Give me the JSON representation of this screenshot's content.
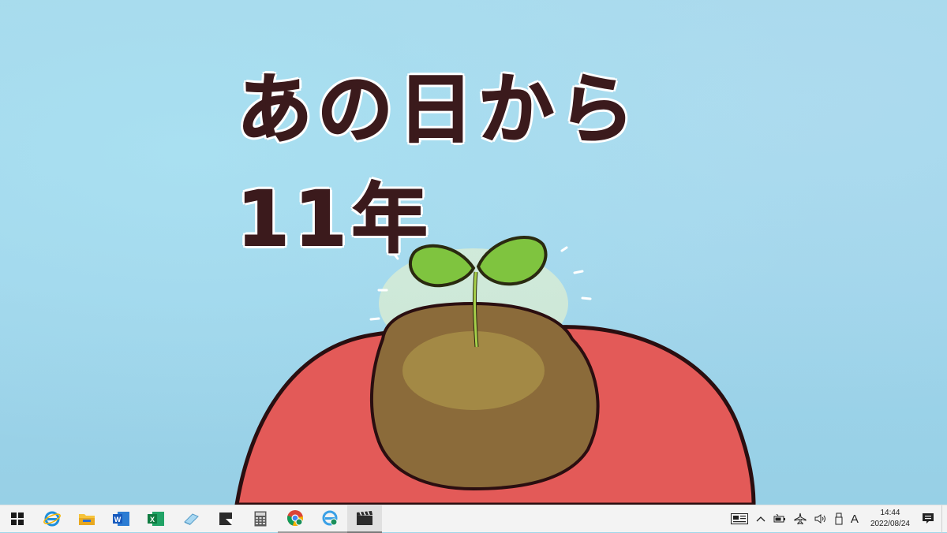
{
  "wallpaper": {
    "title": "あの日から11年"
  },
  "taskbar": {
    "pinned": [
      {
        "name": "start-button",
        "icon": "windows-logo-icon"
      },
      {
        "name": "internet-explorer",
        "icon": "internet-explorer-icon"
      },
      {
        "name": "file-explorer",
        "icon": "folder-icon"
      },
      {
        "name": "word",
        "icon": "word-icon"
      },
      {
        "name": "excel",
        "icon": "excel-icon"
      },
      {
        "name": "notepad-like-app",
        "icon": "eraser-icon"
      },
      {
        "name": "snip-app",
        "icon": "snip-icon"
      },
      {
        "name": "calculator",
        "icon": "calculator-icon"
      },
      {
        "name": "chrome",
        "icon": "chrome-icon"
      },
      {
        "name": "ie-broken",
        "icon": "ie-blue-icon"
      },
      {
        "name": "video-app",
        "icon": "clapperboard-icon"
      }
    ],
    "tray": {
      "ime_label": "A",
      "time": "14:44",
      "date": "2022/08/24"
    }
  },
  "colors": {
    "sky": "#9fd6ea",
    "apple": "#e25a5a",
    "soil": "#8a6a3a",
    "leaf": "#7fc43f",
    "ink": "#3b1a1c"
  }
}
